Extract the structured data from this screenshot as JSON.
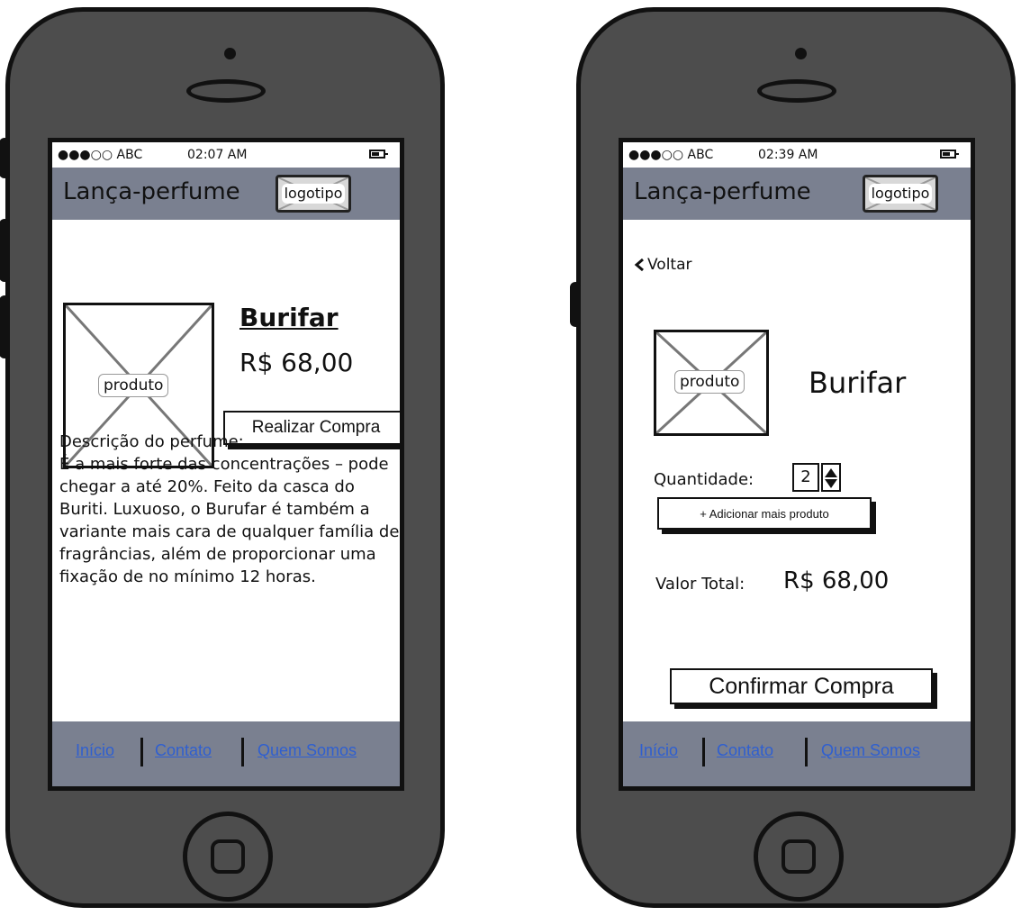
{
  "app": {
    "title": "Lança-perfume",
    "logo_label": "logotipo"
  },
  "status": {
    "carrier": "●●●○○ ABC",
    "time_left": "02:07 AM",
    "time_right": "02:39 AM"
  },
  "product": {
    "image_label": "produto",
    "name": "Burifar",
    "price": "R$ 68,00"
  },
  "detail": {
    "buy_button": "Realizar Compra",
    "description_title": "Descrição do perfume:",
    "description_text": "É a mais forte das concentrações – pode chegar a até 20%. Feito da casca do  Buriti. Luxuoso, o Burufar é também a variante mais cara de qualquer família de fragrâncias, além de proporcionar uma fixação de no mínimo 12 horas."
  },
  "checkout": {
    "back_label": "Voltar",
    "back_icon": "chevron-left-icon",
    "quantity_label": "Quantidade:",
    "quantity_value": "2",
    "add_more_button": "+ Adicionar mais produto",
    "total_label": "Valor Total:",
    "total_value": "R$ 68,00",
    "confirm_button": "Confirmar Compra"
  },
  "footer": {
    "links": [
      "Início",
      "Contato",
      "Quem Somos"
    ]
  },
  "colors": {
    "bar_gray": "#7a8090",
    "phone_body": "#4d4d4d",
    "link_blue": "#2f5fd0"
  }
}
